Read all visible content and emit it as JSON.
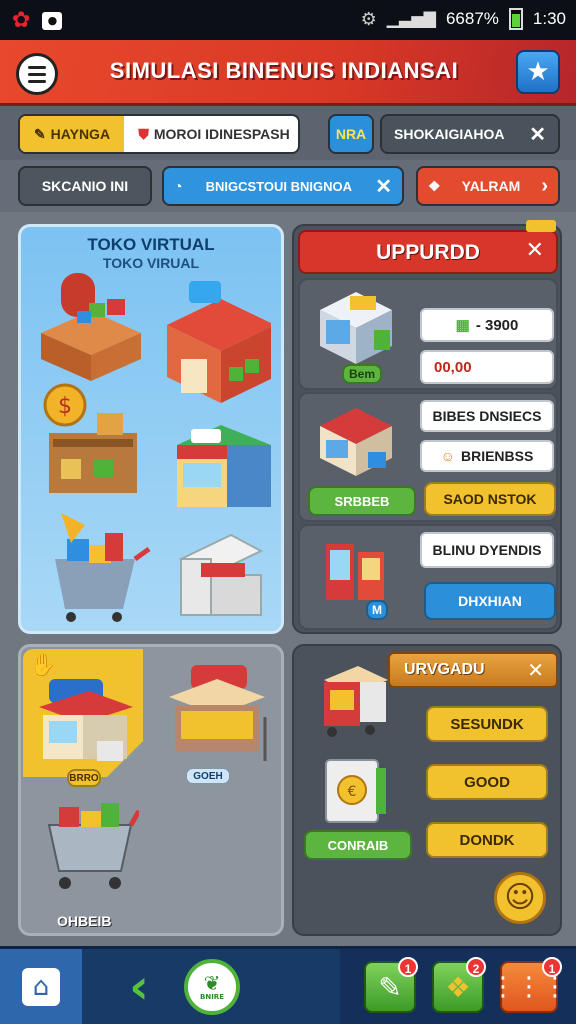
{
  "status_bar": {
    "battery_text": "6687%",
    "time": "1:30"
  },
  "title_bar": {
    "title": "SIMULASI BINENUIS INDIANSAI"
  },
  "tabs_row1": {
    "tab_yellow_label": "HAYNGA",
    "tab_white_label": "MOROI IDINESPASH",
    "tab_blue_label": "NRA",
    "tab_gray_label": "SHOKAIGIAHOA"
  },
  "tabs_row2": {
    "chip_gray_label": "SKCANIO INI",
    "chip_blue_label": "BNIGCSTOUI BNIGNOA",
    "chip_red_label": "YALRAM"
  },
  "store_panel": {
    "title": "TOKO VIRTUAL",
    "subtitle": "TOKO VIRUAL"
  },
  "upgrade_panel": {
    "title": "UPPURDD",
    "row1": {
      "tag": "Bem",
      "price_label": "- 3900",
      "value_label": "00,00"
    },
    "row2": {
      "info_label": "BIBES DNSIECS",
      "item_label": "BRIENBSS",
      "green_button": "SRBBEB",
      "yellow_button": "SAOD NSTOK"
    },
    "row3": {
      "info_label": "BLINU DYENDIS",
      "tag": "M",
      "blue_button": "DHXHIAN"
    }
  },
  "inventory_panel": {
    "item1_tag": "BRRO",
    "item2_tag": "GOEH",
    "item3_label": "OHBEIB"
  },
  "upgrade2_panel": {
    "title": "URVGADU",
    "green_button": "CONRAIB",
    "button1": "SESUNDK",
    "button2": "GOOD",
    "button3": "DONDK"
  },
  "bottom_nav": {
    "center_label": "BNIRE",
    "badge1": "1",
    "badge2": "2",
    "badge3": "1"
  },
  "colors": {
    "title_red": "#d83826",
    "accent_yellow": "#f2c12e",
    "accent_blue": "#2b8fd9",
    "accent_green": "#58b63a",
    "nav_blue": "#173a66"
  }
}
